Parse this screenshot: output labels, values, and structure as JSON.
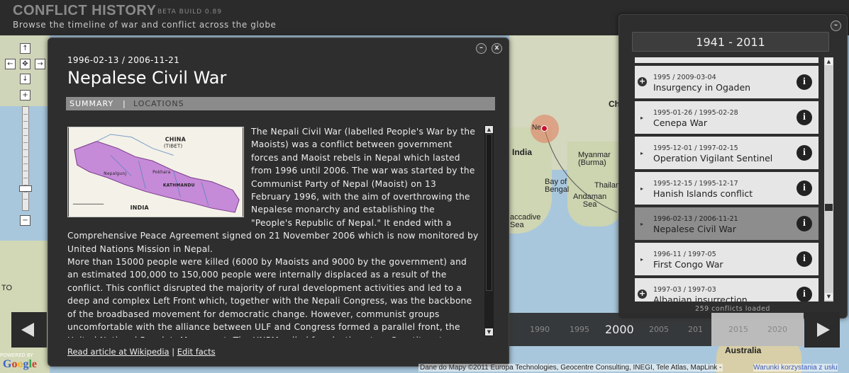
{
  "app": {
    "title": "CONFLICT HISTORY",
    "build": "BETA BUILD 0.89",
    "subtitle": "Browse the timeline of war and conflict across the globe"
  },
  "map": {
    "labels": {
      "india": "India",
      "china": "Chi",
      "myanmar": "Myanmar\n(Burma)",
      "bay_of_bengal": "Bay of\nBengal",
      "andaman_sea": "Andaman\nSea",
      "thailand": "Thailan",
      "laccadive_sea": "accadive\nSea",
      "australia": "Australia",
      "to": "TO",
      "ne_marker": "Ne"
    },
    "accent": "#c8102e"
  },
  "detail": {
    "dates": "1996-02-13 / 2006-11-21",
    "title": "Nepalese Civil War",
    "tabs": {
      "summary": "SUMMARY",
      "separator": "|",
      "locations": "LOCATIONS"
    },
    "image_labels": {
      "china": "CHINA\n(TIBET)",
      "india": "INDIA",
      "kathmandu": "KATHMANDU",
      "pokhara": "Pokhara",
      "nepalgunj": "Nepalgunj"
    },
    "para1": "The Nepali Civil War (labelled People's War by the Maoists) was a conflict between government forces and Maoist rebels in Nepal which lasted from 1996 until 2006. The war was started by the Communist Party of Nepal (Maoist) on 13 February 1996, with the aim of overthrowing the Nepalese monarchy and establishing the \"People's Republic of Nepal.\" It ended with a Comprehensive Peace Agreement signed on 21 November 2006 which is now monitored by United Nations Mission in Nepal.",
    "para2": "More than 15000 people were killed (6000 by Maoists and 9000 by the government) and an estimated 100,000 to 150,000 people were internally displaced as a result of the conflict. This conflict disrupted the majority of rural development activities and led to a deep and complex Left Front which, together with the Nepali Congress, was the backbone of the broadbased movement for democratic change. However, communist groups uncomfortable with the alliance between ULF and Congress formed a parallel front, the United National People's Movement. The UNPM called for elections to a Constituent",
    "links": {
      "wikipedia": "Read article at Wikipedia",
      "separator": "|",
      "edit": "Edit facts"
    },
    "minimize": "–",
    "close": "x"
  },
  "list": {
    "range": "1941 - 2011",
    "minimize": "–",
    "info_glyph": "i",
    "items": [
      {
        "dates": "1995 / 2009-03-04",
        "name": "Insurgency in Ogaden",
        "marker": "+"
      },
      {
        "dates": "1995-01-26 / 1995-02-28",
        "name": "Cenepa War",
        "marker": "▸"
      },
      {
        "dates": "1995-12-01 / 1997-02-15",
        "name": "Operation Vigilant Sentinel",
        "marker": "▸"
      },
      {
        "dates": "1995-12-15 / 1995-12-17",
        "name": "Hanish Islands conflict",
        "marker": "▸"
      },
      {
        "dates": "1996-02-13 / 2006-11-21",
        "name": "Nepalese Civil War",
        "marker": "▸"
      },
      {
        "dates": "1996-11 / 1997-05",
        "name": "First Congo War",
        "marker": "▸"
      },
      {
        "dates": "1997-03 / 1997-03",
        "name": "Albanian insurrection",
        "marker": "+"
      }
    ],
    "count": "259 conflicts loaded"
  },
  "timeline": {
    "years": [
      "1990",
      "1995",
      "2000",
      "2005",
      "201",
      "2015",
      "2020"
    ],
    "current": "2000"
  },
  "footer": {
    "powered": "POWERED BY",
    "google": "Google",
    "attribution": "Dane do Mapy ©2011 Europa Technologies, Geocentre Consulting, INEGI, Tele Atlas, MapLink -",
    "terms": "Warunki korzystania z usłu"
  }
}
